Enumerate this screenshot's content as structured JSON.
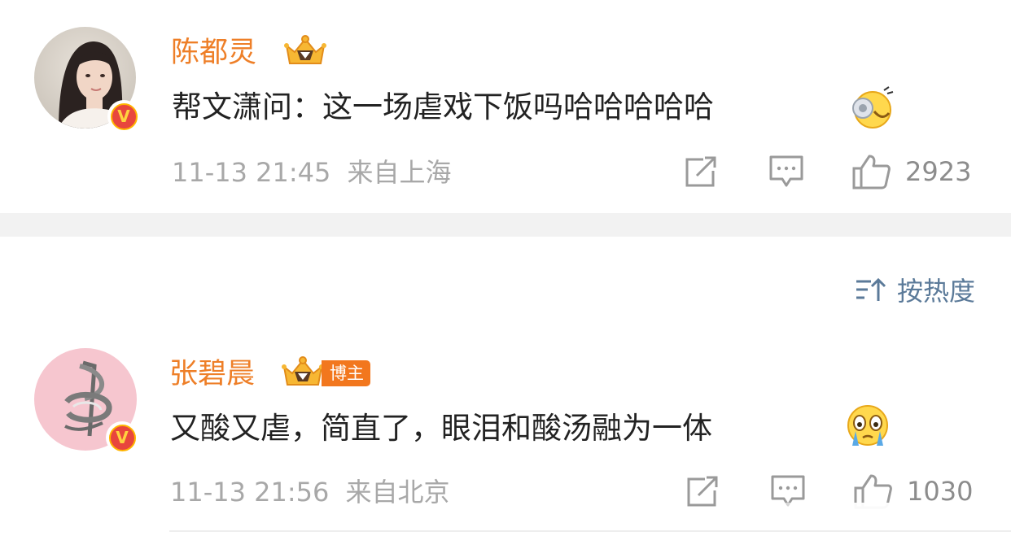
{
  "comments": [
    {
      "username": "陈都灵",
      "text": "帮文潇问：这一场虐戏下饭吗哈哈哈哈哈",
      "emoji": "laughing-crying-emoji",
      "time": "11-13 21:45",
      "location": "来自上海",
      "likes": "2923",
      "avatar": "woman-portrait-avatar",
      "verified_badge": "V"
    },
    {
      "username": "张碧晨",
      "blogger_badge": "博主",
      "text": "又酸又虐，简直了，眼泪和酸汤融为一体",
      "emoji": "teary-eyed-emoji",
      "time": "11-13 21:56",
      "location": "来自北京",
      "likes": "1030",
      "avatar": "pink-logo-avatar",
      "verified_badge": "V"
    }
  ],
  "sort": {
    "label": "按热度",
    "icon": "sort-by-heat-icon"
  },
  "colors": {
    "username": "#ee7f28",
    "meta": "#a8a8a8",
    "sort": "#5b7a99",
    "separator": "#f2f2f2",
    "badge": "#f2771e"
  }
}
